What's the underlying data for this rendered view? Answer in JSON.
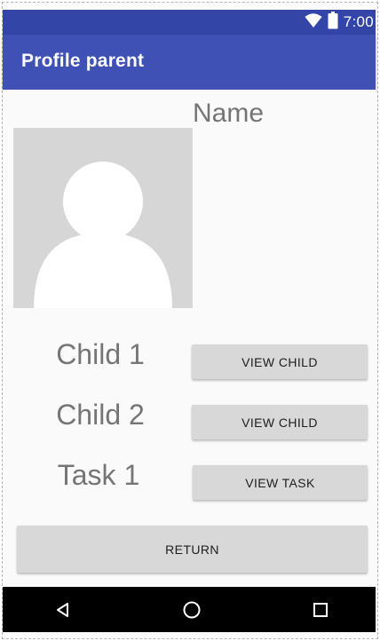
{
  "status_bar": {
    "time": "7:00",
    "icons": [
      "wifi-icon",
      "battery-icon"
    ]
  },
  "app_bar": {
    "title": "Profile parent"
  },
  "profile": {
    "name_label": "Name",
    "avatar_icon": "person-placeholder-icon"
  },
  "rows": [
    {
      "label": "Child 1",
      "button": "VIEW CHILD"
    },
    {
      "label": "Child 2",
      "button": "VIEW CHILD"
    },
    {
      "label": "Task 1",
      "button": "VIEW TASK"
    }
  ],
  "return_button": "RETURN",
  "nav_bar": {
    "icons": [
      "back-icon",
      "home-icon",
      "recents-icon"
    ]
  },
  "colors": {
    "status_bar": "#3345a6",
    "app_bar": "#3f51b5",
    "background": "#fafafa",
    "button": "#d8d8d8",
    "avatar_bg": "#d6d6d6",
    "label_text": "#757575"
  }
}
